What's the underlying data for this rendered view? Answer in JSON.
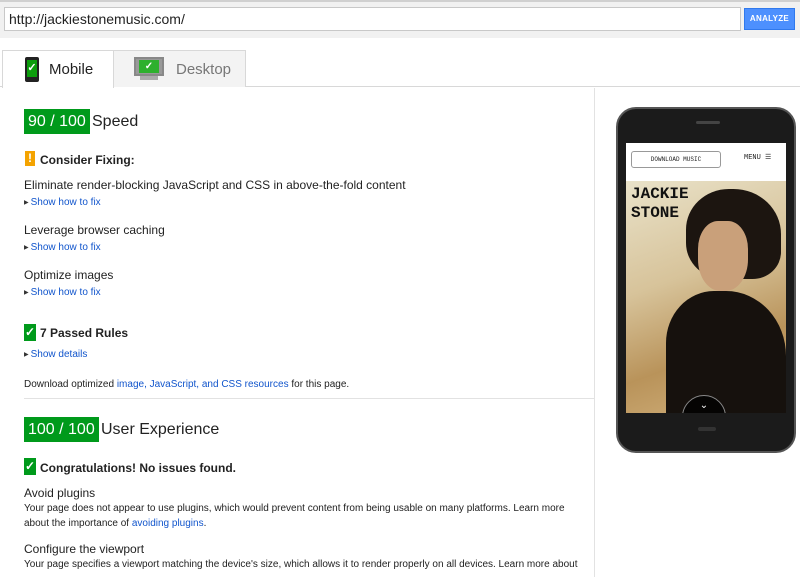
{
  "toolbar": {
    "url_value": "http://jackiestonemusic.com/",
    "analyze_label": "ANALYZE"
  },
  "tabs": [
    {
      "label": "Mobile",
      "icon": "phone-check-icon",
      "active": true
    },
    {
      "label": "Desktop",
      "icon": "monitor-check-icon",
      "active": false
    }
  ],
  "speed": {
    "score": "90 / 100",
    "title": "Speed",
    "consider_heading": "Consider Fixing:",
    "rules": [
      {
        "title": "Eliminate render-blocking JavaScript and CSS in above-the-fold content",
        "link": "Show how to fix"
      },
      {
        "title": "Leverage browser caching",
        "link": "Show how to fix"
      },
      {
        "title": "Optimize images",
        "link": "Show how to fix"
      }
    ],
    "passed_heading": "7 Passed Rules",
    "show_details": "Show details",
    "download_pre": "Download optimized ",
    "download_link": "image, JavaScript, and CSS resources",
    "download_post": " for this page."
  },
  "ux": {
    "score": "100 / 100",
    "title": "User Experience",
    "congrats": "Congratulations! No issues found.",
    "plugins_title": "Avoid plugins",
    "plugins_text": "Your page does not appear to use plugins, which would prevent content from being usable on many platforms. Learn more about the importance of ",
    "plugins_link": "avoiding plugins",
    "plugins_end": ".",
    "viewport_title": "Configure the viewport",
    "viewport_text": "Your page specifies a viewport matching the device's size, which allows it to render properly on all devices. Learn more about"
  },
  "preview": {
    "download_button": "DOWNLOAD MUSIC",
    "menu_label": "MENU ☰",
    "artist_name": "JACKIE STONE",
    "scroll_icon": "chevron-down-icon"
  },
  "colors": {
    "score_green": "#009a1b",
    "warning_orange": "#f4a300",
    "link_blue": "#1155cc",
    "button_blue": "#4d90fe"
  }
}
